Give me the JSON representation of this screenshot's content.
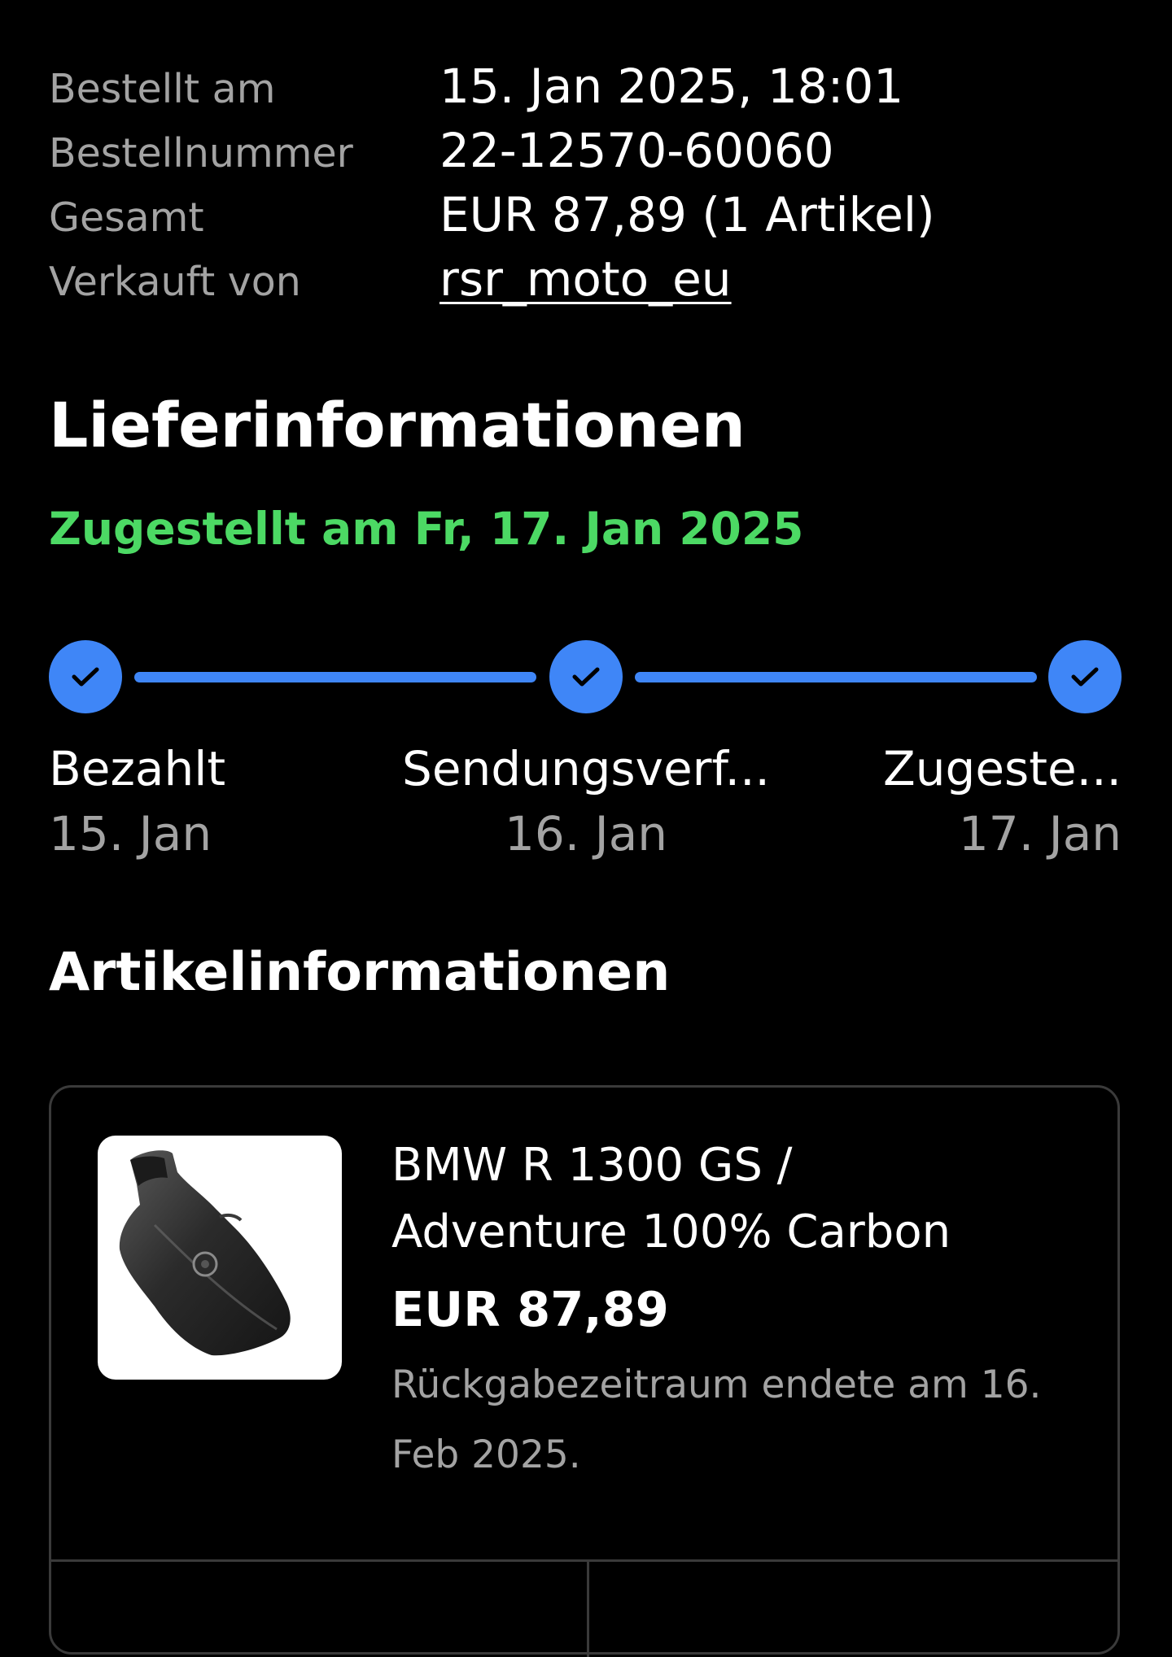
{
  "order_summary": {
    "rows": [
      {
        "label": "Bestellt am",
        "value": "15. Jan 2025, 18:01"
      },
      {
        "label": "Bestellnummer",
        "value": "22-12570-60060"
      },
      {
        "label": "Gesamt",
        "value": "EUR 87,89 (1 Artikel)"
      },
      {
        "label": "Verkauft von",
        "value": "rsr_moto_eu"
      }
    ]
  },
  "delivery": {
    "title": "Lieferinformationen",
    "status": "Zugestellt am Fr, 17. Jan 2025",
    "status_color": "#4cd964",
    "accent_color": "#3f86f7",
    "steps": [
      {
        "name": "Bezahlt",
        "date": "15. Jan",
        "icon": "check-icon"
      },
      {
        "name": "Sendungsverf...",
        "date": "16. Jan",
        "icon": "check-icon"
      },
      {
        "name": "Zugeste...",
        "date": "17. Jan",
        "icon": "check-icon"
      }
    ]
  },
  "items": {
    "title": "Artikelinformationen",
    "list": [
      {
        "name_line1": "BMW R 1300 GS /",
        "name_line2": "Adventure 100% Carbon",
        "price": "EUR 87,89",
        "return_line1": "Rückgabezeitraum endete am 16.",
        "return_line2": "Feb 2025.",
        "image": "carbon-part-image"
      }
    ]
  }
}
